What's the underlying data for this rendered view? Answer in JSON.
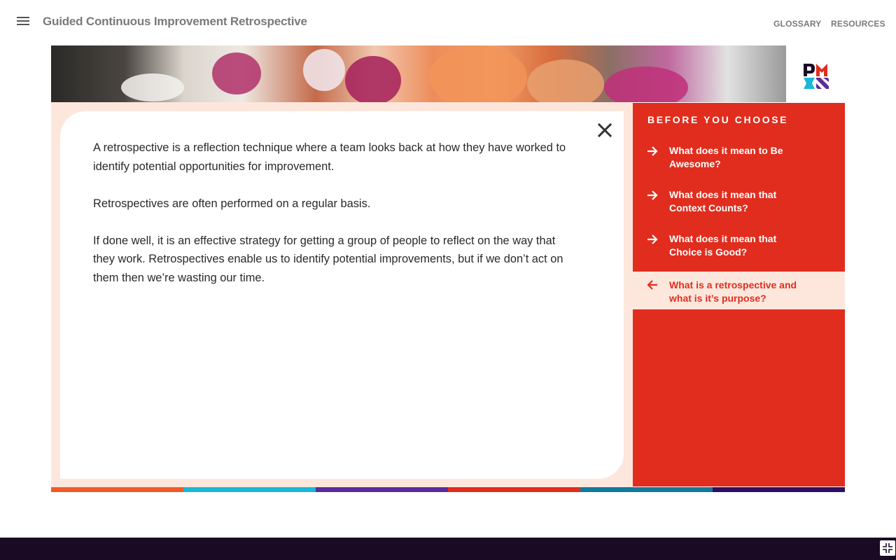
{
  "header": {
    "title": "Guided Continuous Improvement Retrospective",
    "links": [
      "GLOSSARY",
      "RESOURCES"
    ]
  },
  "logo": {
    "text": "PMI"
  },
  "content": {
    "paragraphs": [
      "A retrospective is a reflection technique where a team looks back at how they have worked to identify potential opportunities for improvement.",
      "Retrospectives are often performed on a regular basis.",
      "If done well, it is an effective strategy for getting a group of people to reflect on the way that they work. Retrospectives enable us to identify potential improvements, but if we don’t act on them then we’re wasting our time."
    ]
  },
  "sidebar": {
    "heading": "BEFORE YOU CHOOSE",
    "items": [
      {
        "label": "What does it mean to Be Awesome?",
        "icon": "arrow-right-icon",
        "active": false
      },
      {
        "label": "What does it mean that Context Counts?",
        "icon": "arrow-right-icon",
        "active": false
      },
      {
        "label": "What does it mean that Choice is Good?",
        "icon": "arrow-right-icon",
        "active": false
      },
      {
        "label": "What is a retrospective and what is it’s purpose?",
        "icon": "arrow-left-icon",
        "active": true
      }
    ]
  },
  "colors": {
    "accent_red": "#e12d1e",
    "panel_peach": "#fde7dd",
    "footer": "#1a0a24",
    "stripe": [
      "#f05a28",
      "#1ab7d8",
      "#5c2c9a",
      "#e12d1e",
      "#127a9c",
      "#2d1066"
    ]
  },
  "icons": {
    "menu": "hamburger-icon",
    "close": "close-icon",
    "fullscreen": "exit-fullscreen-icon"
  }
}
